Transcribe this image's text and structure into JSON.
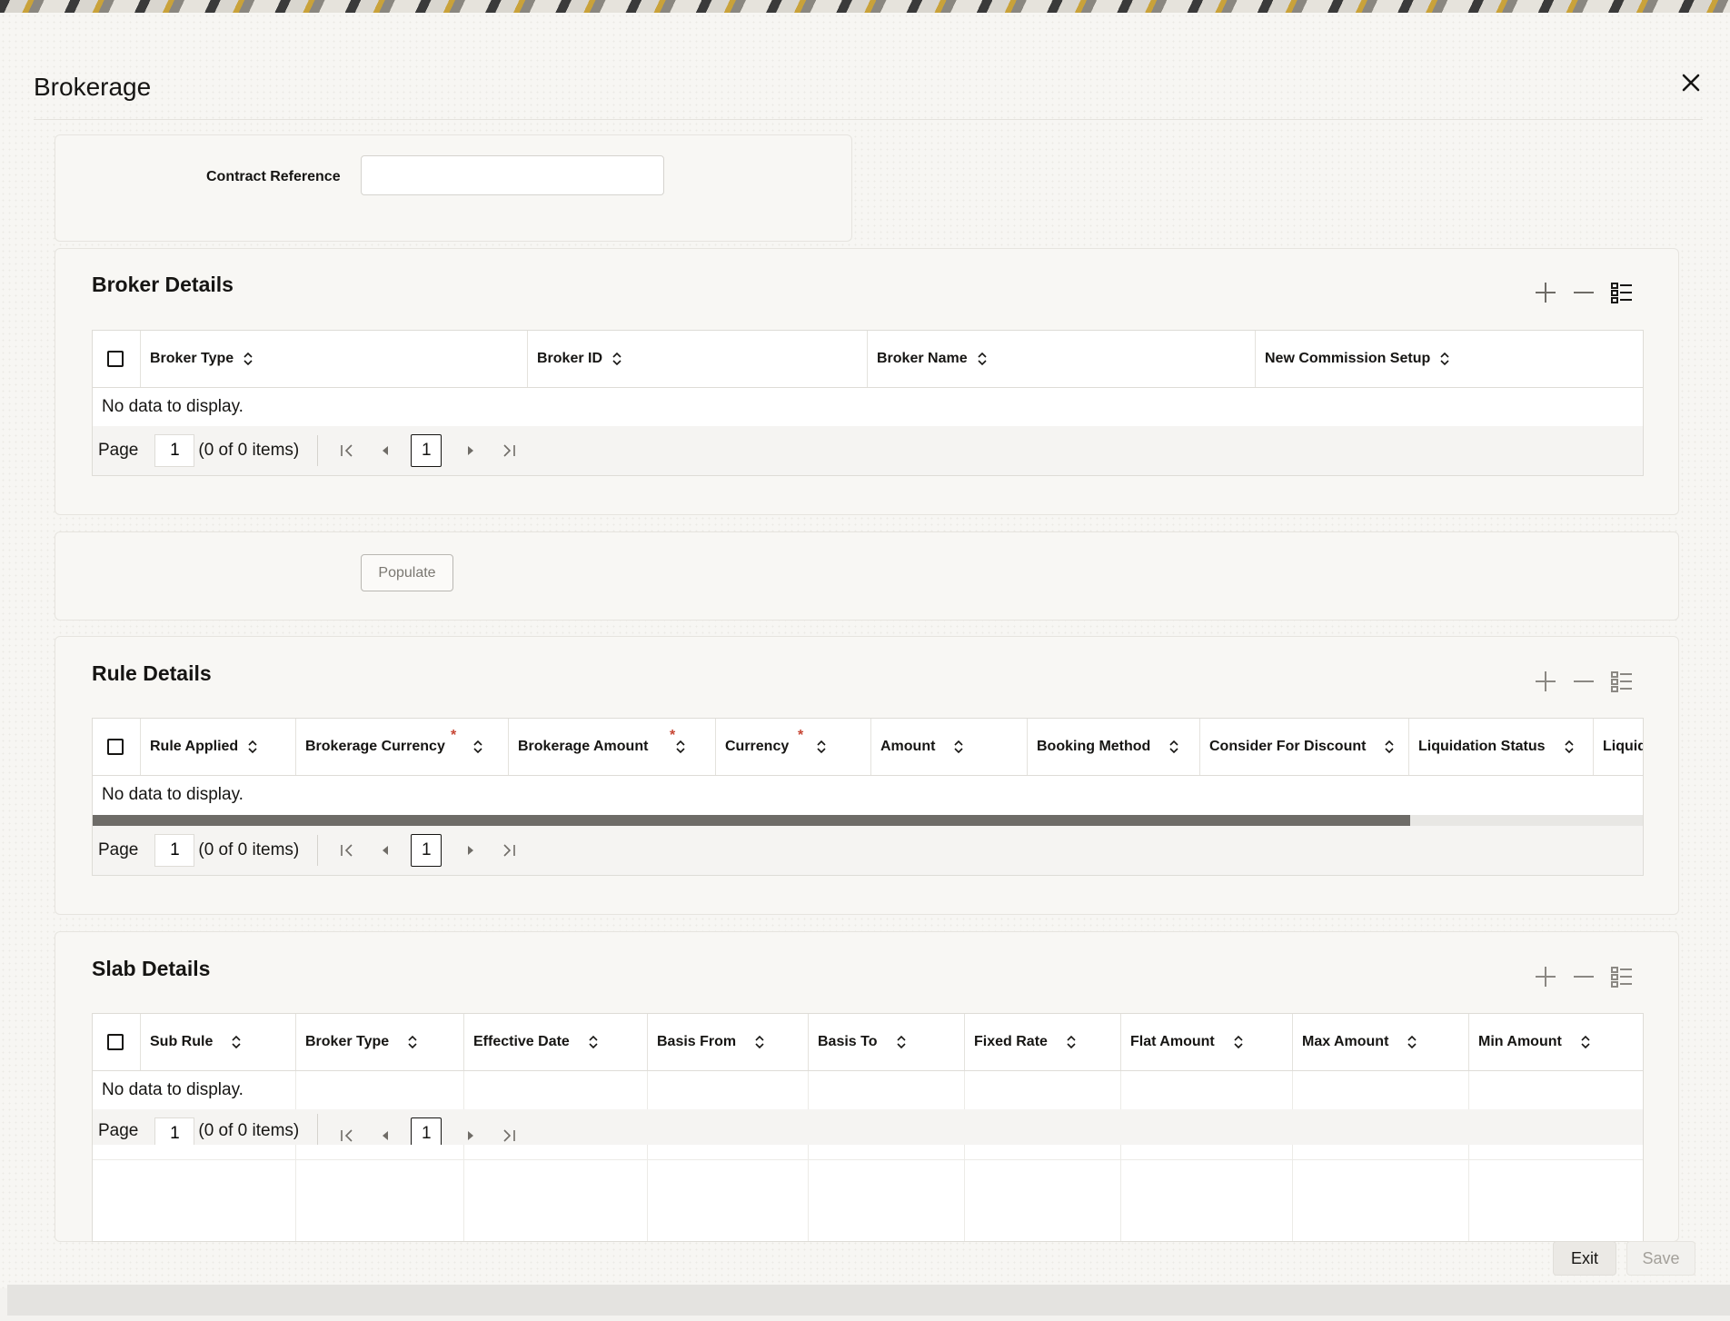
{
  "dialog": {
    "title": "Brokerage"
  },
  "contract": {
    "label": "Contract Reference",
    "value": ""
  },
  "broker_details": {
    "title": "Broker Details",
    "columns": [
      "Broker Type",
      "Broker ID",
      "Broker Name",
      "New Commission Setup"
    ],
    "empty_text": "No data to display.",
    "pager": {
      "label": "Page",
      "page": "1",
      "info": "(0 of 0 items)",
      "current": "1"
    }
  },
  "populate": {
    "label": "Populate"
  },
  "rule_details": {
    "title": "Rule Details",
    "columns": [
      "Rule Applied",
      "Brokerage Currency",
      "Brokerage Amount",
      "Currency",
      "Amount",
      "Booking Method",
      "Consider For Discount",
      "Liquidation Status",
      "Liquid"
    ],
    "empty_text": "No data to display.",
    "pager": {
      "label": "Page",
      "page": "1",
      "info": "(0 of 0 items)",
      "current": "1"
    },
    "scroll_fraction": 0.85
  },
  "slab_details": {
    "title": "Slab Details",
    "columns": [
      "Sub Rule",
      "Broker Type",
      "Effective Date",
      "Basis From",
      "Basis To",
      "Fixed Rate",
      "Flat Amount",
      "Max Amount",
      "Min Amount"
    ],
    "empty_text": "No data to display.",
    "pager": {
      "label": "Page",
      "page": "1",
      "info": "(0 of 0 items)",
      "current": "1"
    }
  },
  "footer": {
    "exit_label": "Exit",
    "save_label": "Save"
  },
  "colors": {
    "accent": "#161513",
    "required": "#c74634",
    "scroll_thumb": "#6e6c68"
  }
}
